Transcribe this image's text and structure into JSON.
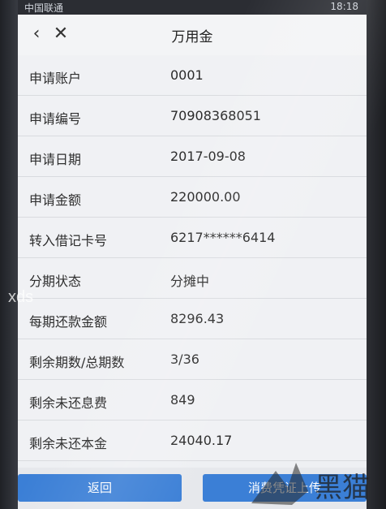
{
  "statusbar": {
    "left": "中国联通",
    "time": "18:18"
  },
  "navbar": {
    "title": "万用金",
    "back_icon": "chevron-left-icon",
    "close_icon": "close-icon"
  },
  "rows": [
    {
      "label": "申请账户",
      "value": "0001"
    },
    {
      "label": "申请编号",
      "value": "70908368051"
    },
    {
      "label": "申请日期",
      "value": "2017-09-08"
    },
    {
      "label": "申请金额",
      "value": "220000.00"
    },
    {
      "label": "转入借记卡号",
      "value": "6217******6414"
    },
    {
      "label": "分期状态",
      "value": "分摊中"
    },
    {
      "label": "每期还款金额",
      "value": "8296.43"
    },
    {
      "label": "剩余期数/总期数",
      "value": "3/36"
    },
    {
      "label": "剩余未还息费",
      "value": "849"
    },
    {
      "label": "剩余未还本金",
      "value": "24040.17"
    }
  ],
  "buttons": {
    "back": "返回",
    "upload": "消费凭证上传"
  },
  "watermarks": {
    "left": "xds",
    "right": "黑猫"
  },
  "colors": {
    "button_blue": "#3b7fd6",
    "screen_bg": "#eef0f3"
  }
}
